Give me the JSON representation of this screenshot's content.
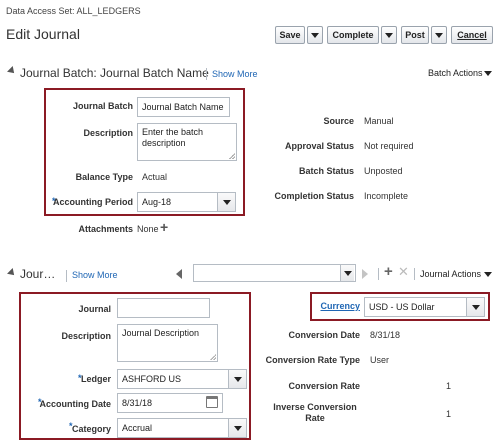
{
  "data_access_set": "Data Access Set: ALL_LEDGERS",
  "page_title": "Edit Journal",
  "toolbar": {
    "save": "Save",
    "complete": "Complete",
    "post": "Post",
    "cancel": "Cancel"
  },
  "batch": {
    "header": "Journal Batch: Journal Batch Name",
    "show_more": "Show More",
    "actions": "Batch Actions",
    "journal_batch_label": "Journal Batch",
    "journal_batch_value": "Journal Batch Name",
    "description_label": "Description",
    "description_value": "Enter the batch description",
    "balance_type_label": "Balance Type",
    "balance_type_value": "Actual",
    "accounting_period_label": "Accounting Period",
    "accounting_period_value": "Aug-18",
    "attachments_label": "Attachments",
    "attachments_value": "None",
    "source_label": "Source",
    "source_value": "Manual",
    "approval_status_label": "Approval Status",
    "approval_status_value": "Not required",
    "batch_status_label": "Batch Status",
    "batch_status_value": "Unposted",
    "completion_status_label": "Completion Status",
    "completion_status_value": "Incomplete"
  },
  "journal": {
    "header": "Jour…",
    "show_more": "Show More",
    "actions": "Journal Actions",
    "journal_label": "Journal",
    "journal_value": "",
    "description_label": "Description",
    "description_value": "Journal Description",
    "ledger_label": "Ledger",
    "ledger_value": "ASHFORD US",
    "accounting_date_label": "Accounting Date",
    "accounting_date_value": "8/31/18",
    "category_label": "Category",
    "category_value": "Accrual",
    "currency_label": "Currency",
    "currency_value": "USD - US Dollar",
    "conversion_date_label": "Conversion Date",
    "conversion_date_value": "8/31/18",
    "conversion_rate_type_label": "Conversion Rate Type",
    "conversion_rate_type_value": "User",
    "conversion_rate_label": "Conversion Rate",
    "conversion_rate_value": "1",
    "inverse_conversion_rate_label": "Inverse Conversion Rate",
    "inverse_conversion_rate_value": "1"
  },
  "colors": {
    "highlight_border": "#8b1a24",
    "link": "#1f66b4"
  }
}
